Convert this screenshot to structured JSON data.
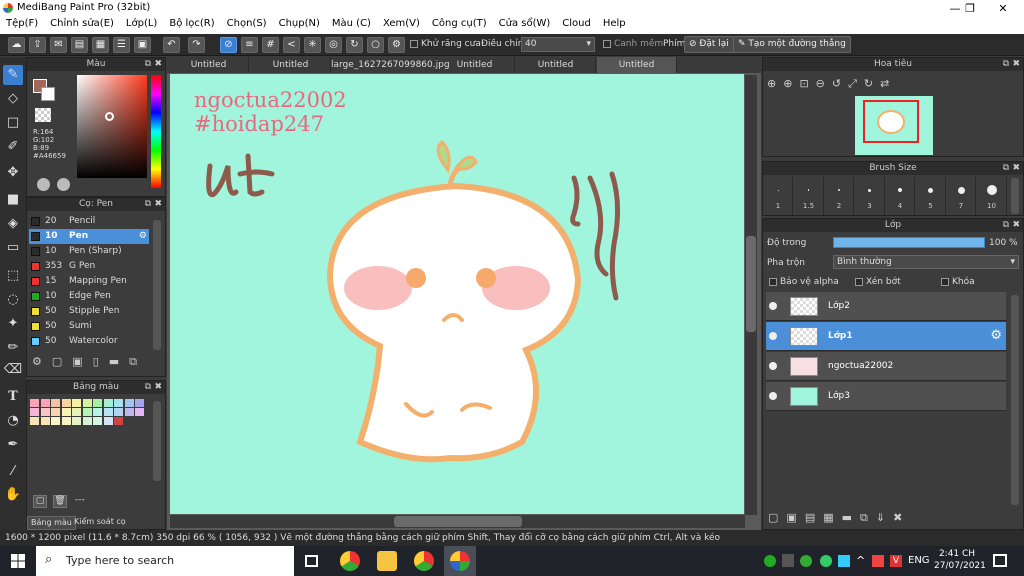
{
  "window": {
    "title": "MediBang Paint Pro (32bit)",
    "min": "—",
    "max": "❐",
    "close": "✕"
  },
  "menu": [
    "Tệp(F)",
    "Chỉnh sửa(E)",
    "Lớp(L)",
    "Bộ lọc(R)",
    "Chọn(S)",
    "Chụp(N)",
    "Màu (C)",
    "Xem(V)",
    "Công cụ(T)",
    "Cửa sổ(W)",
    "Cloud",
    "Help"
  ],
  "toolbar": {
    "antialias": "Khử răng cưa",
    "adjust_label": "Điều chỉnh",
    "adjust_value": "40",
    "smooth": "Canh mềm",
    "key_label": "Phím",
    "reset": "Đặt lại",
    "straight": "Tạo một đường thẳng"
  },
  "color_panel": {
    "title": "Màu",
    "r": "R:164",
    "g": "G:102",
    "b": "B:89",
    "hex": "#A46659",
    "fg": "#a46659"
  },
  "brush_panel": {
    "title": "Cọ: Pen",
    "items": [
      {
        "size": "20",
        "name": "Pencil",
        "color": "#2b2b2b"
      },
      {
        "size": "10",
        "name": "Pen",
        "color": "#2b2b2b"
      },
      {
        "size": "10",
        "name": "Pen (Sharp)",
        "color": "#2b2b2b"
      },
      {
        "size": "353",
        "name": "G Pen",
        "color": "#e33"
      },
      {
        "size": "15",
        "name": "Mapping Pen",
        "color": "#e33"
      },
      {
        "size": "10",
        "name": "Edge Pen",
        "color": "#2a2"
      },
      {
        "size": "50",
        "name": "Stipple Pen",
        "color": "#ed3"
      },
      {
        "size": "50",
        "name": "Sumi",
        "color": "#ed3"
      },
      {
        "size": "50",
        "name": "Watercolor",
        "color": "#6cf"
      }
    ]
  },
  "palette_panel": {
    "title": "Bảng màu",
    "dashes": "---",
    "tab1": "Bảng màu",
    "tab2": "Kiểm soát cọ"
  },
  "tabs": [
    "Untitled",
    "Untitled",
    "large_1627267099860.jpg",
    "Untitled",
    "Untitled",
    "Untitled"
  ],
  "art": {
    "line1": "ngoctua22002",
    "line2": "#hoidap247",
    "scribble": "ut"
  },
  "navigator": {
    "title": "Hoa tiêu"
  },
  "brushsize": {
    "title": "Brush Size",
    "sizes": [
      "1",
      "1.5",
      "2",
      "3",
      "4",
      "5",
      "7",
      "10"
    ]
  },
  "layers": {
    "title": "Lớp",
    "opacity_label": "Độ trong",
    "opacity_value": "100 %",
    "blend_label": "Pha trộn",
    "blend_value": "Bình thường",
    "protect_alpha": "Bảo vệ alpha",
    "clip": "Xén bớt",
    "lock": "Khóa",
    "items": [
      {
        "name": "Lớp2"
      },
      {
        "name": "Lớp1"
      },
      {
        "name": "ngoctua22002"
      },
      {
        "name": "Lớp3"
      }
    ]
  },
  "status": {
    "size": "1600 * 1200 pixel",
    "cm": "(11.6 * 8.7cm)",
    "dpi": "350 dpi",
    "zoom": "66 %",
    "coords": "( 1056, 932 )",
    "hint": "Vẽ một đường thẳng bằng cách giữ phím Shift, Thay đổi cỡ cọ bằng cách giữ phím Ctrl, Alt và kéo"
  },
  "taskbar": {
    "search": "Type here to search",
    "lang": "ENG",
    "time": "2:41 CH",
    "date": "27/07/2021"
  }
}
